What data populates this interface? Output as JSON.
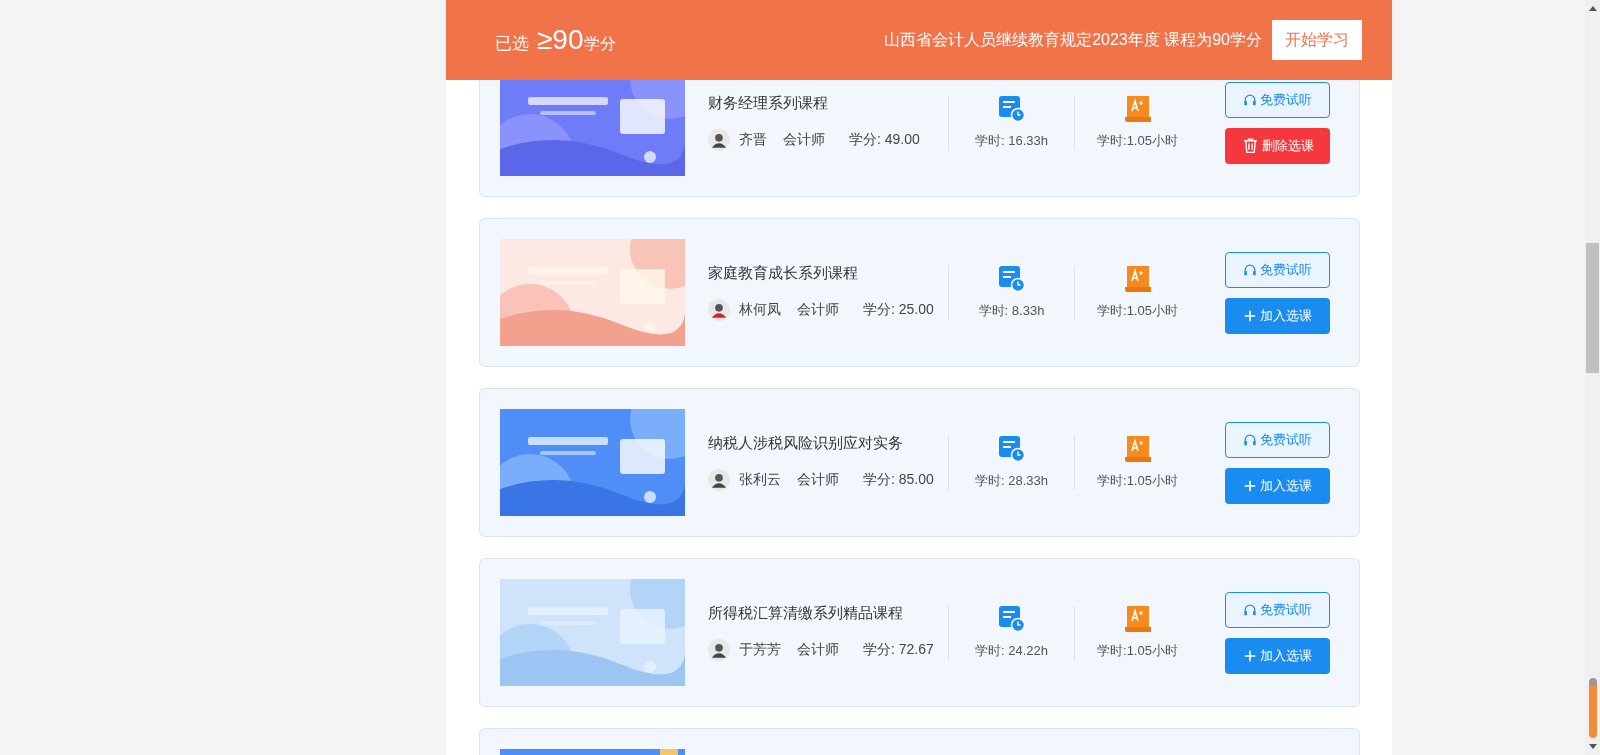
{
  "header": {
    "selected_label": "已选",
    "threshold": "≥90",
    "unit": "学分",
    "notice": "山西省会计人员继续教育规定2023年度 课程为90学分",
    "start_button": "开始学习"
  },
  "courses": [
    {
      "title": "财务经理系列课程",
      "teacher": "齐晋",
      "role": "会计师",
      "credit": "学分: 49.00",
      "hours": "学时: 16.33h",
      "duration": "学时:1.05小时",
      "trial": "免费试听",
      "selected": true,
      "action": "删除选课"
    },
    {
      "title": "家庭教育成长系列课程",
      "teacher": "林何凤",
      "role": "会计师",
      "credit": "学分: 25.00",
      "hours": "学时: 8.33h",
      "duration": "学时:1.05小时",
      "trial": "免费试听",
      "selected": false,
      "action": "加入选课"
    },
    {
      "title": "纳税人涉税风险识别应对实务",
      "teacher": "张利云",
      "role": "会计师",
      "credit": "学分: 85.00",
      "hours": "学时: 28.33h",
      "duration": "学时:1.05小时",
      "trial": "免费试听",
      "selected": false,
      "action": "加入选课"
    },
    {
      "title": "所得税汇算清缴系列精品课程",
      "teacher": "于芳芳",
      "role": "会计师",
      "credit": "学分: 72.67",
      "hours": "学时: 24.22h",
      "duration": "学时:1.05小时",
      "trial": "免费试听",
      "selected": false,
      "action": "加入选课"
    }
  ]
}
